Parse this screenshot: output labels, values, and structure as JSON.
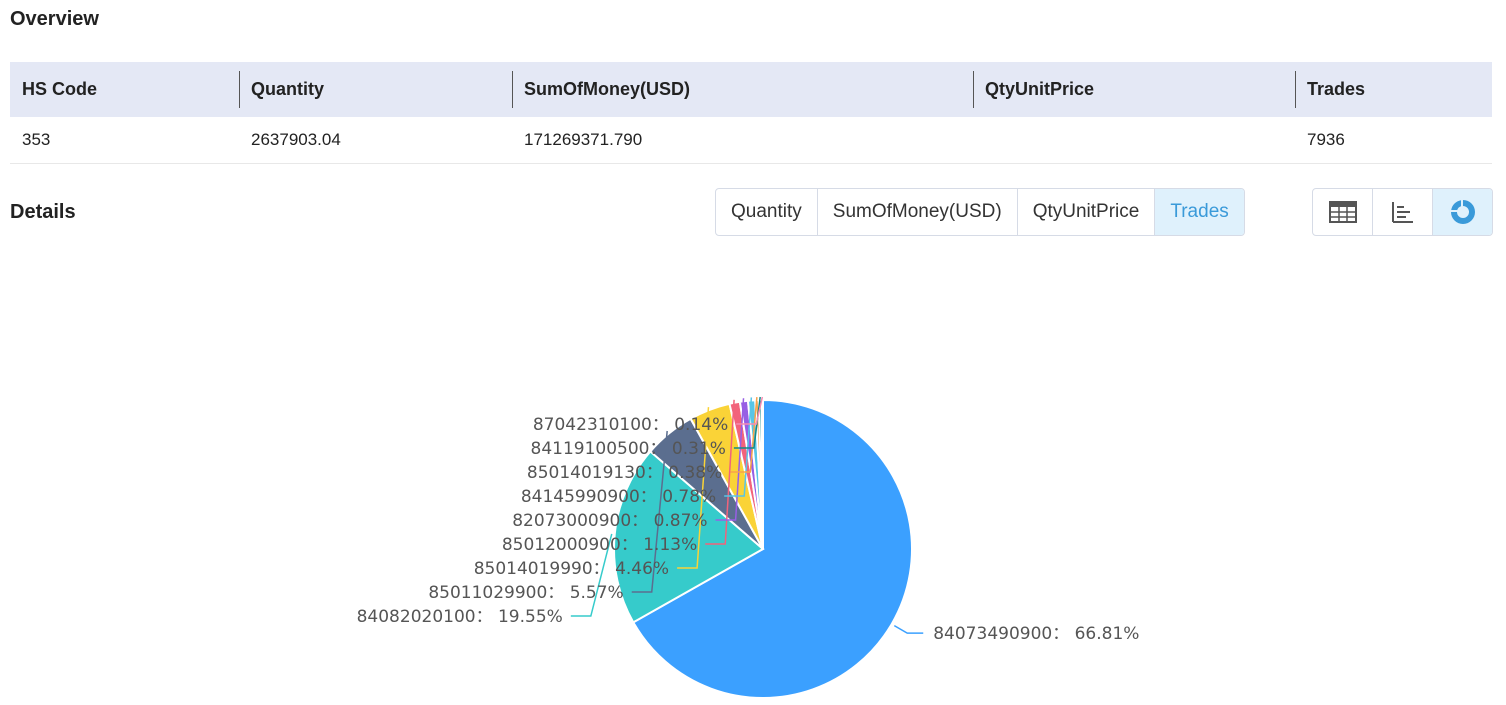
{
  "overview": {
    "title": "Overview",
    "columns": [
      "HS Code",
      "Quantity",
      "SumOfMoney(USD)",
      "QtyUnitPrice",
      "Trades"
    ],
    "row": [
      "353",
      "2637903.04",
      "171269371.790",
      "",
      "7936"
    ]
  },
  "details": {
    "title": "Details",
    "tabs": [
      "Quantity",
      "SumOfMoney(USD)",
      "QtyUnitPrice",
      "Trades"
    ],
    "active_tab": "Trades",
    "view_buttons": [
      "table-view-icon",
      "bar-chart-icon",
      "pie-chart-icon"
    ],
    "active_view": "pie-chart-icon"
  },
  "chart_data": {
    "type": "pie",
    "slices": [
      {
        "label": "84073490900",
        "value": 66.81,
        "color": "#3ba0ff"
      },
      {
        "label": "84082020100",
        "value": 19.55,
        "color": "#36cbcb"
      },
      {
        "label": "85011029900",
        "value": 5.57,
        "color": "#5b6e8f"
      },
      {
        "label": "85014019990",
        "value": 4.46,
        "color": "#fad337"
      },
      {
        "label": "85012000900",
        "value": 1.13,
        "color": "#f2637b"
      },
      {
        "label": "82073000900",
        "value": 0.87,
        "color": "#975fe4"
      },
      {
        "label": "84145990900",
        "value": 0.78,
        "color": "#58c5e7"
      },
      {
        "label": "85014019130",
        "value": 0.38,
        "color": "#f7a34b"
      },
      {
        "label": "84119100500",
        "value": 0.31,
        "color": "#0f8a8a"
      },
      {
        "label": "87042310100",
        "value": 0.14,
        "color": "#f58bb1"
      }
    ]
  }
}
